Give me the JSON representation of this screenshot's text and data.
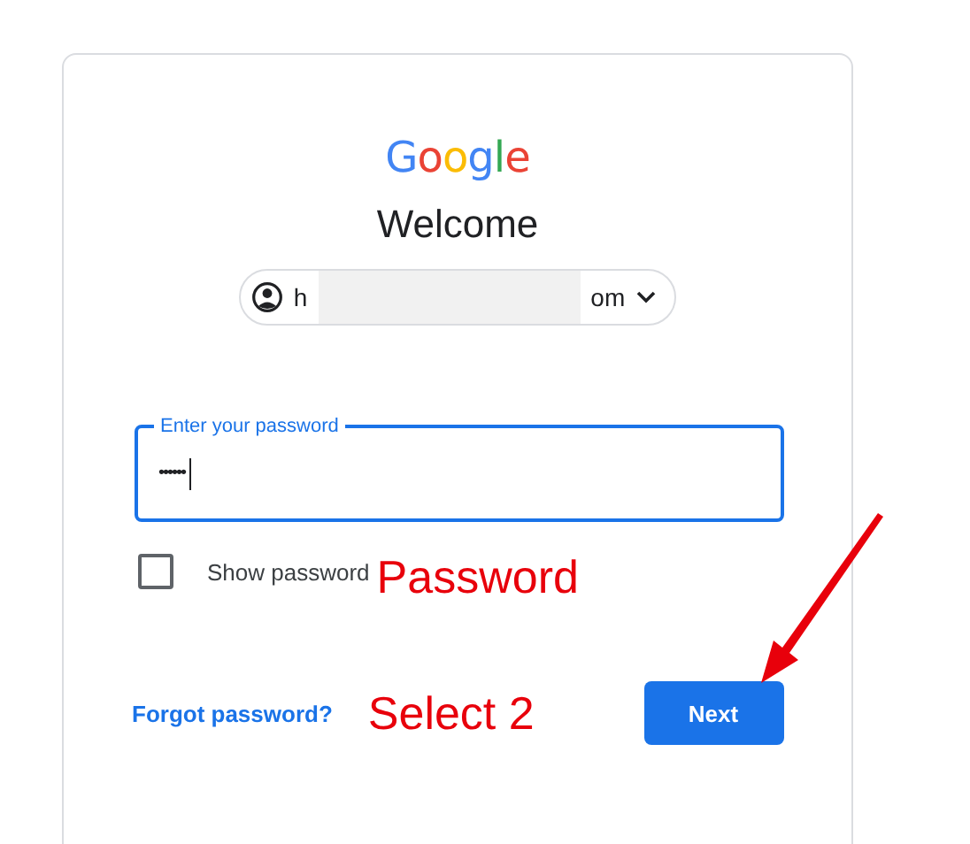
{
  "logo": "Google",
  "heading": "Welcome",
  "account": {
    "text_start": "h",
    "text_end": "om",
    "redacted": true
  },
  "password_field": {
    "label": "Enter your password",
    "value": "••••••",
    "focused": true
  },
  "show_password": {
    "label": "Show password",
    "checked": false
  },
  "forgot_link": "Forgot password?",
  "next_button": "Next",
  "annotations": [
    {
      "text": "Password"
    },
    {
      "text": "Select 2"
    }
  ]
}
